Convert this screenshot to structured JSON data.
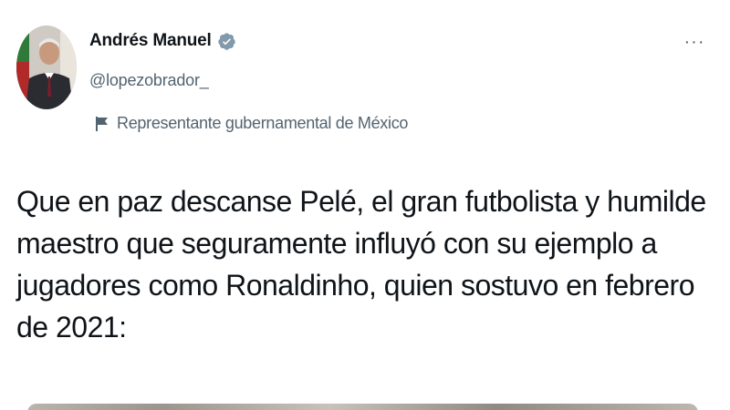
{
  "author": {
    "display_name": "Andrés Manuel",
    "handle": "@lopezobrador_",
    "verified": true,
    "affiliation": "Representante gubernamental de México",
    "avatar_icon": "profile-photo",
    "verified_badge_color": "#829aab"
  },
  "tweet": {
    "text": "Que en paz descanse Pelé, el gran futbolista y humilde maestro que seguramente influyó con su ejemplo a jugadores como Ronaldinho, quien sostuvo en febrero de 2021:"
  },
  "actions": {
    "more_icon": "more-horizontal-icon",
    "more_label": "···"
  },
  "colors": {
    "text_primary": "#0f1419",
    "text_secondary": "#536471",
    "background": "#ffffff"
  }
}
